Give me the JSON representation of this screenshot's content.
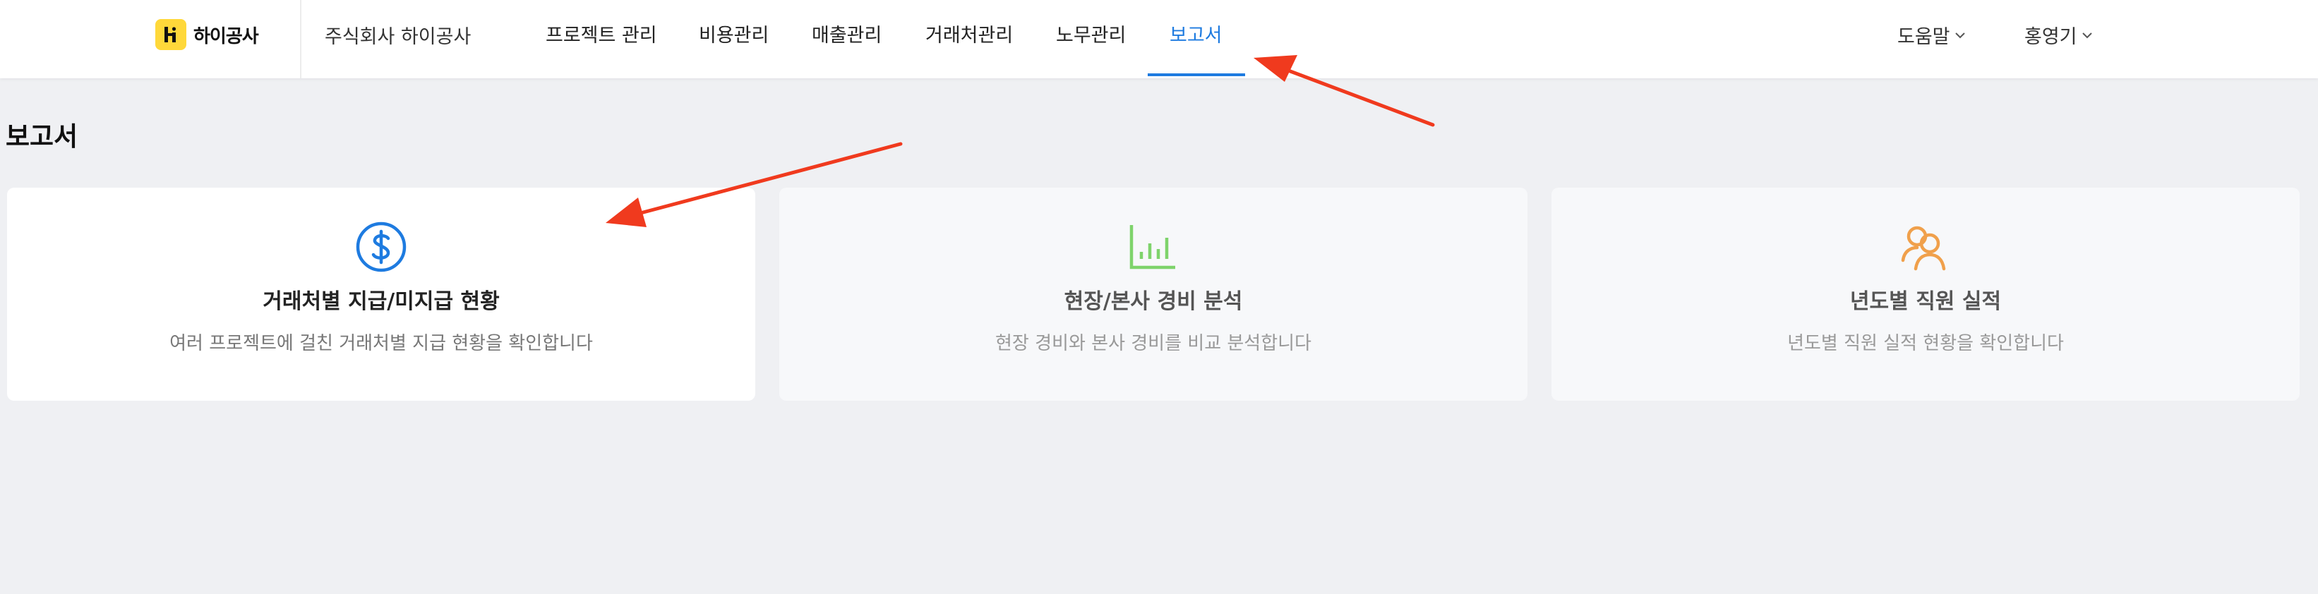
{
  "header": {
    "logo_text": "하이공사",
    "company": "주식회사 하이공사",
    "nav": [
      {
        "label": "프로젝트 관리"
      },
      {
        "label": "비용관리"
      },
      {
        "label": "매출관리"
      },
      {
        "label": "거래처관리"
      },
      {
        "label": "노무관리"
      },
      {
        "label": "보고서"
      }
    ],
    "active_nav": "보고서",
    "help_label": "도움말",
    "user_label": "홍영기"
  },
  "page": {
    "title": "보고서"
  },
  "cards": [
    {
      "title": "거래처별 지급/미지급 현황",
      "desc": "여러 프로젝트에 걸친 거래처별 지급 현황을 확인합니다",
      "icon": "dollar-icon",
      "color": "#1e7be0"
    },
    {
      "title": "현장/본사 경비 분석",
      "desc": "현장 경비와 본사 경비를 비교 분석합니다",
      "icon": "bar-chart-icon",
      "color": "#7ed36b"
    },
    {
      "title": "년도별 직원 실적",
      "desc": "년도별 직원 실적 현황을 확인합니다",
      "icon": "users-icon",
      "color": "#f0a04b"
    }
  ],
  "colors": {
    "accent": "#1e7be0",
    "annotation_arrow": "#f03a1e",
    "logo_bg": "#ffd83a"
  }
}
